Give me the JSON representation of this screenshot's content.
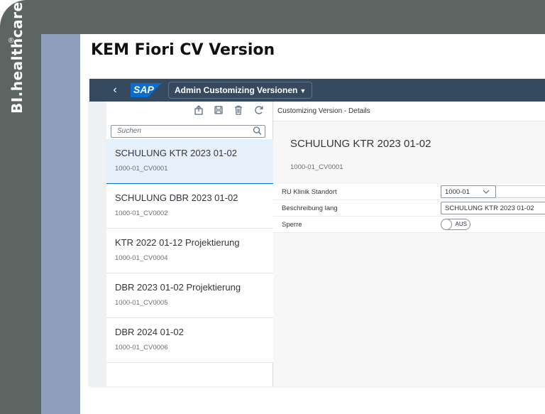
{
  "branding": {
    "logo_text": "BI.healthcare",
    "reg_mark": "®"
  },
  "slide_title": "KEM Fiori CV Version",
  "shell": {
    "app_title": "Admin Customizing Versionen",
    "logo": "SAP",
    "back_icon": "back-arrow-icon"
  },
  "master": {
    "toolbar_icons": [
      "upload-icon",
      "save-icon",
      "delete-icon",
      "refresh-icon"
    ],
    "search_placeholder": "Suchen",
    "items": [
      {
        "title": "SCHULUNG KTR 2023 01-02",
        "subtitle": "1000-01_CV0001",
        "selected": true
      },
      {
        "title": "SCHULUNG DBR 2023 01-02",
        "subtitle": "1000-01_CV0002",
        "selected": false
      },
      {
        "title": "KTR 2022 01-12 Projektierung",
        "subtitle": "1000-01_CV0004",
        "selected": false
      },
      {
        "title": "DBR 2023 01-02 Projektierung",
        "subtitle": "1000-01_CV0005",
        "selected": false
      },
      {
        "title": "DBR 2024 01-02",
        "subtitle": "1000-01_CV0006",
        "selected": false
      }
    ]
  },
  "detail": {
    "header": "Customizing Version - Details",
    "object_title": "SCHULUNG KTR 2023 01-02",
    "object_subtitle": "1000-01_CV0001",
    "fields": {
      "standort_label": "RU Klinik Standort",
      "standort_value": "1000-01",
      "beschreibung_label": "Beschreibung lang",
      "beschreibung_value": "SCHULUNG KTR 2023 01-02",
      "sperre_label": "Sperre",
      "sperre_value": "AUS"
    }
  },
  "colors": {
    "shell": "#354a5f",
    "accent": "#0a6ed1",
    "frame_dark": "#5d6562",
    "frame_blue": "#8f9fbd"
  }
}
